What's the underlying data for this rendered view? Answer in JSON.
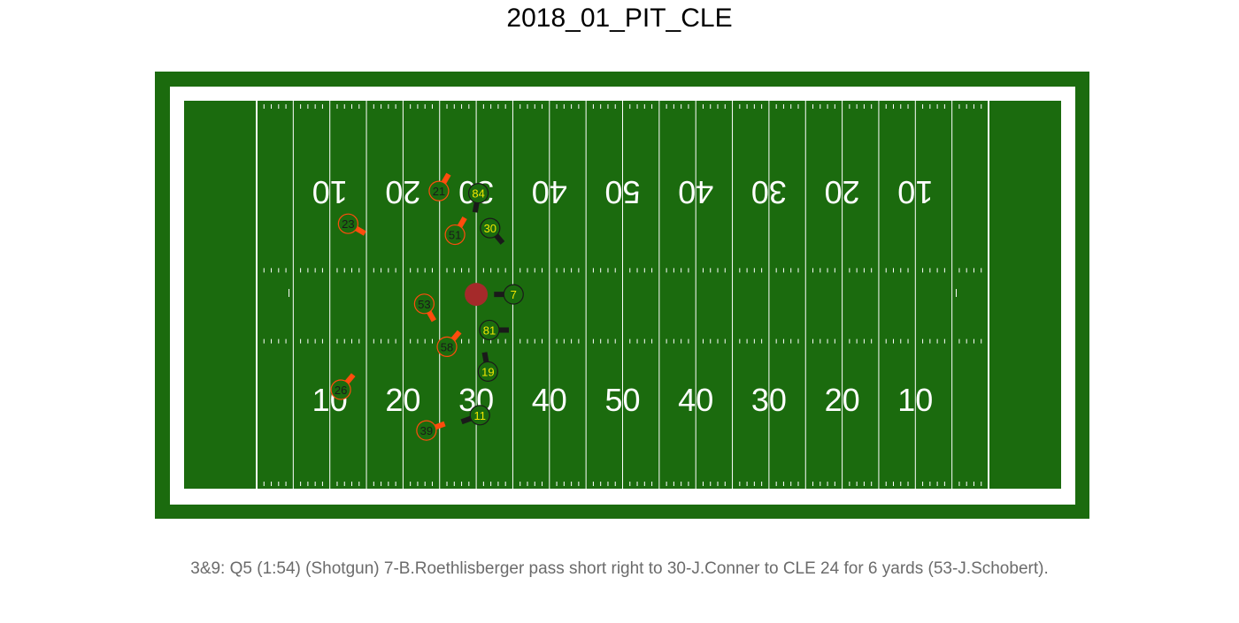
{
  "title": "2018_01_PIT_CLE",
  "caption": "3&9: Q5 (1:54) (Shotgun) 7-B.Roethlisberger pass short right to 30-J.Conner to CLE 24 for 6 yards (53-J.Schobert).",
  "colors": {
    "field": "#1b6b0e",
    "lines": "#ffffff",
    "football": "#a52a2a",
    "offense_fill": "#1a1a1a",
    "offense_label": "#f2e600",
    "defense_color": "#ff4c0d",
    "defense_label": "#1a1a1a"
  },
  "yard_numbers_bottom": [
    "10",
    "20",
    "30",
    "40",
    "50",
    "40",
    "30",
    "20",
    "10"
  ],
  "yard_numbers_top": [
    "10",
    "20",
    "30",
    "40",
    "50",
    "40",
    "30",
    "20",
    "10"
  ],
  "football": {
    "yardline": 30,
    "y": 26.6
  },
  "players": {
    "offense": [
      {
        "jersey": "84",
        "yardline": 30.3,
        "y": 12.7,
        "dir": 190
      },
      {
        "jersey": "30",
        "yardline": 31.9,
        "y": 17.5,
        "dir": 140
      },
      {
        "jersey": "7",
        "yardline": 35.1,
        "y": 26.6,
        "dir": 270
      },
      {
        "jersey": "81",
        "yardline": 31.8,
        "y": 31.5,
        "dir": 90
      },
      {
        "jersey": "19",
        "yardline": 31.6,
        "y": 37.2,
        "dir": 350
      },
      {
        "jersey": "11",
        "yardline": 30.5,
        "y": 43.2,
        "dir": 250
      }
    ],
    "defense": [
      {
        "jersey": "21",
        "yardline": 24.9,
        "y": 12.4,
        "dir": 30
      },
      {
        "jersey": "23",
        "yardline": 12.5,
        "y": 16.9,
        "dir": 120
      },
      {
        "jersey": "51",
        "yardline": 27.1,
        "y": 18.4,
        "dir": 30
      },
      {
        "jersey": "53",
        "yardline": 22.9,
        "y": 27.9,
        "dir": 150
      },
      {
        "jersey": "58",
        "yardline": 26.0,
        "y": 33.8,
        "dir": 40
      },
      {
        "jersey": "26",
        "yardline": 11.5,
        "y": 39.7,
        "dir": 40
      },
      {
        "jersey": "39",
        "yardline": 23.2,
        "y": 45.3,
        "dir": 70
      }
    ]
  }
}
